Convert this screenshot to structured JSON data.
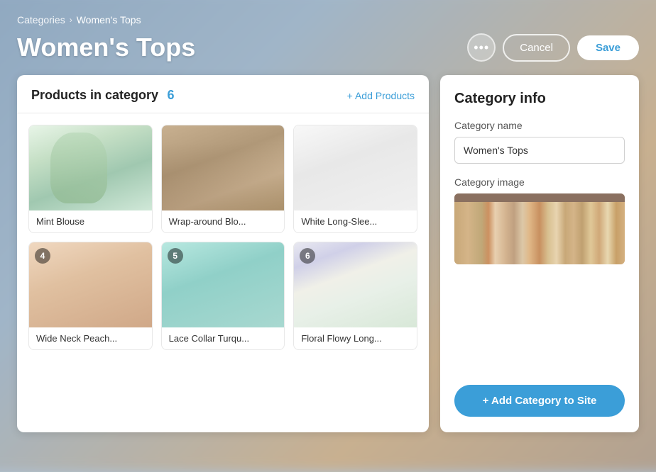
{
  "breadcrumb": {
    "parent": "Categories",
    "current": "Women's Tops"
  },
  "header": {
    "title": "Women's Tops",
    "more_label": "•••",
    "cancel_label": "Cancel",
    "save_label": "Save"
  },
  "left_panel": {
    "title": "Products in category",
    "count": "6",
    "add_link": "+ Add Products",
    "products": [
      {
        "id": 1,
        "name": "Mint Blouse",
        "img_class": "img-mint"
      },
      {
        "id": 2,
        "name": "Wrap-around Blo...",
        "img_class": "img-wrap"
      },
      {
        "id": 3,
        "name": "White Long-Slee...",
        "img_class": "img-white"
      },
      {
        "id": 4,
        "name": "Wide Neck Peach...",
        "img_class": "img-peach"
      },
      {
        "id": 5,
        "name": "Lace Collar Turqu...",
        "img_class": "img-turq"
      },
      {
        "id": 6,
        "name": "Floral Flowy Long...",
        "img_class": "img-floral"
      }
    ]
  },
  "right_panel": {
    "title": "Category info",
    "category_name_label": "Category name",
    "category_name_value": "Women's Tops",
    "category_image_label": "Category image",
    "add_category_btn": "+ Add Category to Site"
  }
}
